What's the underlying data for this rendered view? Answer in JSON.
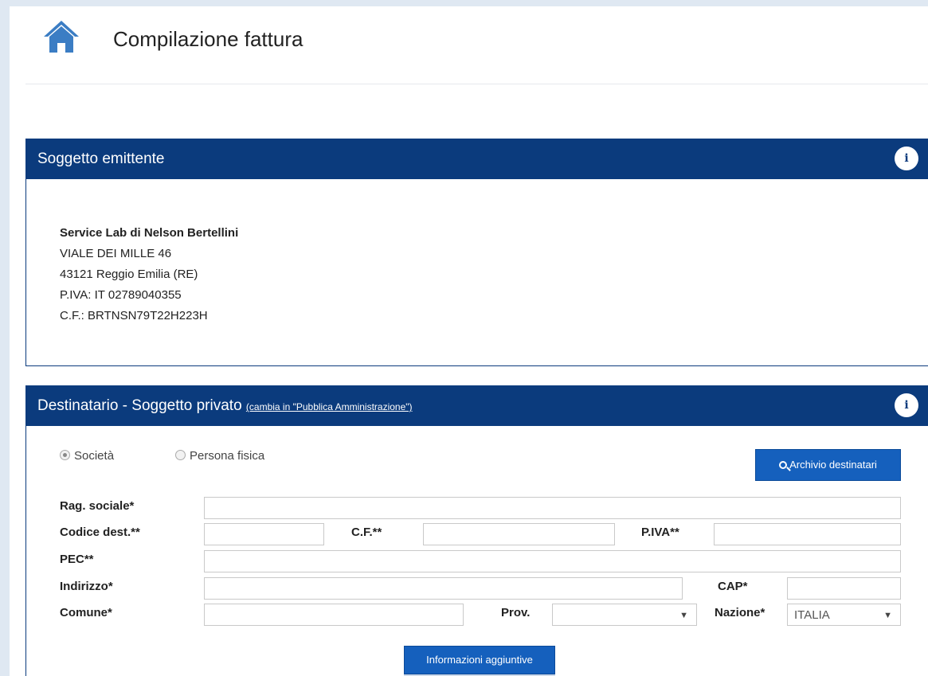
{
  "header": {
    "title": "Compilazione fattura",
    "icon": "home-icon"
  },
  "issuer_panel": {
    "title": "Soggetto emittente",
    "info_icon": "i",
    "name": "Service Lab di Nelson Bertellini",
    "address": "VIALE DEI MILLE 46",
    "city": "43121 Reggio Emilia (RE)",
    "vat": "P.IVA: IT 02789040355",
    "tax_code": "C.F.: BRTNSN79T22H223H"
  },
  "recipient_panel": {
    "title": "Destinatario - Soggetto privato",
    "switch_link": "(cambia in \"Pubblica Amministrazione\")",
    "info_icon": "i",
    "radio_company": "Società",
    "radio_person": "Persona fisica",
    "selected_radio": "Società",
    "archive_button": "Archivio destinatari",
    "more_button": "Informazioni aggiuntive",
    "labels": {
      "company_name": "Rag. sociale*",
      "recipient_code": "Codice dest.**",
      "tax_code": "C.F.**",
      "vat": "P.IVA**",
      "pec": "PEC**",
      "address": "Indirizzo*",
      "zip": "CAP*",
      "city": "Comune*",
      "province": "Prov.",
      "country": "Nazione*"
    },
    "values": {
      "country": "ITALIA"
    }
  },
  "colors": {
    "panel_header": "#0b3b7d",
    "button": "#1560bd",
    "background": "#dfe8f2"
  }
}
